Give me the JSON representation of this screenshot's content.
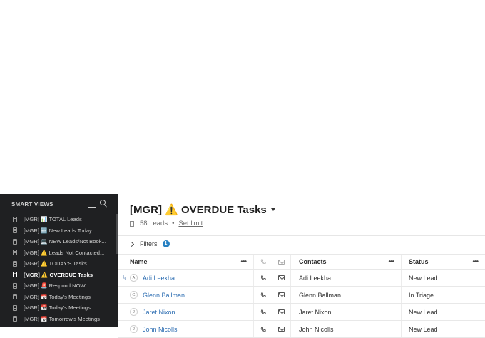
{
  "sidebar": {
    "header": "SMART VIEWS",
    "items": [
      {
        "label": "[MGR] 📊 TOTAL Leads",
        "active": false
      },
      {
        "label": "[MGR] 🆕 New Leads Today",
        "active": false
      },
      {
        "label": "[MGR] 💻 NEW Leads/Not Book...",
        "active": false
      },
      {
        "label": "[MGR] ⚠️ Leads Not Contacted...",
        "active": false
      },
      {
        "label": "[MGR] ⚠️ TODAY'S Tasks",
        "active": false
      },
      {
        "label": "[MGR] ⚠️ OVERDUE Tasks",
        "active": true
      },
      {
        "label": "[MGR] 🚨 Respond NOW",
        "active": false
      },
      {
        "label": "[MGR] 📅 Today's Meetings",
        "active": false
      },
      {
        "label": "[MGR] 📅 Today's Meetings",
        "active": false
      },
      {
        "label": "[MGR] 📅 Tomorrow's Meetings",
        "active": false
      }
    ]
  },
  "view": {
    "title": "[MGR] ⚠️ OVERDUE Tasks",
    "lead_count": "58 Leads",
    "separator": "•",
    "set_limit": "Set limit"
  },
  "filters": {
    "label": "Filters",
    "badge": "1"
  },
  "table": {
    "columns": {
      "name": "Name",
      "contacts": "Contacts",
      "status": "Status",
      "more": "•••"
    },
    "rows": [
      {
        "initial": "A",
        "name": "Adi Leekha",
        "contact": "Adi Leekha",
        "status": "New Lead"
      },
      {
        "initial": "G",
        "name": "Glenn Ballman",
        "contact": "Glenn Ballman",
        "status": "In Triage"
      },
      {
        "initial": "J",
        "name": "Jaret Nixon",
        "contact": "Jaret Nixon",
        "status": "New Lead"
      },
      {
        "initial": "J",
        "name": "John Nicolls",
        "contact": "John Nicolls",
        "status": "New Lead"
      }
    ]
  },
  "colors": {
    "sidebar_bg": "#1f2022",
    "link": "#2f6fb3",
    "info_badge": "#2680c2"
  }
}
